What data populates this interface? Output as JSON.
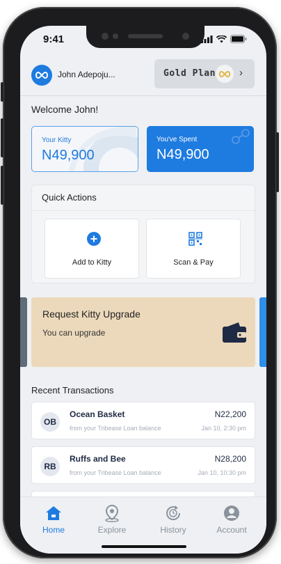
{
  "status_bar": {
    "time": "9:41"
  },
  "header": {
    "user_name": "John Adepoju...",
    "plan_label": "Gold Plan",
    "plan_chevron": "›"
  },
  "welcome": "Welcome John!",
  "cards": {
    "kitty": {
      "label": "Your Kitty",
      "value": "N49,900"
    },
    "spent": {
      "label": "You've Spent",
      "value": "N49,900"
    }
  },
  "quick_actions": {
    "title": "Quick Actions",
    "items": [
      {
        "label": "Add to Kitty",
        "icon": "plus-circle-icon"
      },
      {
        "label": "Scan & Pay",
        "icon": "qr-code-icon"
      }
    ]
  },
  "upgrade": {
    "title": "Request Kitty Upgrade",
    "subtitle": "You can upgrade",
    "icon": "wallet-icon"
  },
  "recent": {
    "title": "Recent Transactions",
    "items": [
      {
        "initials": "OB",
        "name": "Ocean Basket",
        "source": "from  your Tribease  Loan balance",
        "amount": "N22,200",
        "date": "Jan 10, 2:30 pm"
      },
      {
        "initials": "RB",
        "name": "Ruffs and Bee",
        "source": "from  your Tribease  Loan balance",
        "amount": "N28,200",
        "date": "Jan 10, 10:30 pm"
      }
    ]
  },
  "tabs": [
    {
      "label": "Home",
      "icon": "home-icon",
      "active": true
    },
    {
      "label": "Explore",
      "icon": "map-pin-icon",
      "active": false
    },
    {
      "label": "History",
      "icon": "history-icon",
      "active": false
    },
    {
      "label": "Account",
      "icon": "user-icon",
      "active": false
    }
  ],
  "colors": {
    "primary": "#1e7be0",
    "upgrade_bg": "#ecd9bb",
    "screen_bg": "#eef0f3"
  }
}
